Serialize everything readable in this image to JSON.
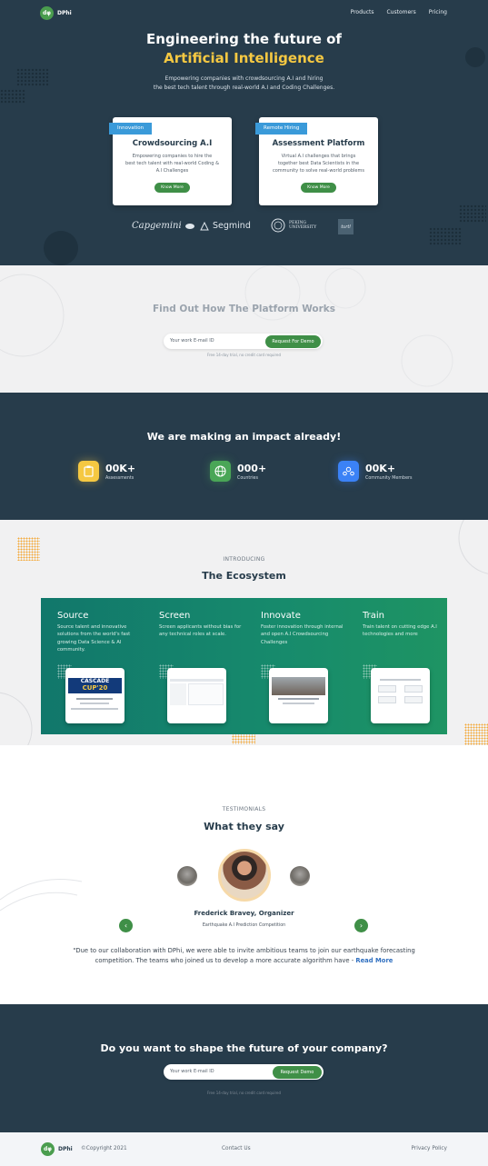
{
  "brand": {
    "logo_mark": "dφ",
    "name": "DPhi"
  },
  "nav": {
    "items": [
      "Products",
      "Customers",
      "Pricing"
    ]
  },
  "hero": {
    "title_line1": "Engineering the future of",
    "title_line2": "Artificial Intelligence",
    "subtitle_line1": "Empowering companies with crowdsourcing A.I and hiring",
    "subtitle_line2": "the best tech talent through real-world A.I and Coding Challenges."
  },
  "cards": [
    {
      "tag": "Innovation",
      "title": "Crowdsourcing A.I",
      "text_line1": "Empowering companies to hire the",
      "text_line2": "best tech talent with real-world Coding &",
      "text_line3": "A.I Challenges",
      "button": "Know More"
    },
    {
      "tag": "Remote Hiring",
      "title": "Assessment Platform",
      "text_line1": "Virtual A.I challenges that brings",
      "text_line2": "together best Data Scientists in the",
      "text_line3": "community to solve real-world problems",
      "button": "Know More"
    }
  ],
  "partners": {
    "capgemini": "Capgemini",
    "segmind": "Segmind",
    "peking_line1": "PEKING",
    "peking_line2": "UNIVERSITY",
    "turtl": "turtl"
  },
  "demo": {
    "title": "Find Out How The Platform Works",
    "email_placeholder": "Your work E-mail ID",
    "button": "Request For Demo",
    "note": "Free 14-day trial, no credit card required"
  },
  "impact": {
    "title": "We are making an impact already!",
    "stats": [
      {
        "value": "00K+",
        "label": "Assessments",
        "icon": "clipboard-icon",
        "color": "#f5c842"
      },
      {
        "value": "000+",
        "label": "Countries",
        "icon": "globe-icon",
        "color": "#4aa657"
      },
      {
        "value": "00K+",
        "label": "Community Members",
        "icon": "community-icon",
        "color": "#3b82f6"
      }
    ]
  },
  "ecosystem": {
    "intro": "INTRODUCING",
    "title": "The Ecosystem",
    "columns": [
      {
        "title": "Source",
        "text": "Source talent and innovative solutions from the world's fast growing Data Science & AI community."
      },
      {
        "title": "Screen",
        "text": "Screen applicants without bias for any technical roles at scale."
      },
      {
        "title": "Innovate",
        "text": "Foster innovation through internal and open A.I Crowdsourcing Challenges"
      },
      {
        "title": "Train",
        "text": "Train talent on cutting edge A.I technologies and more"
      }
    ],
    "cascade_line1": "CASCADE",
    "cascade_line2": "CUP'20"
  },
  "testimonials": {
    "intro": "TESTIMONIALS",
    "title": "What they say",
    "name": "Frederick Bravey, Organizer",
    "role": "Earthquake A.I Prediction Competition",
    "quote": "\"Due to our collaboration with DPhi, we were able to invite ambitious teams to join our earthquake forecasting competition. The teams who joined us to develop a more accurate algorithm have - ",
    "read_more": "Read More"
  },
  "cta": {
    "title": "Do you want to shape the future of your company?",
    "email_placeholder": "Your work E-mail ID",
    "button": "Request Demo",
    "note": "Free 14-day trial, no credit card required"
  },
  "footer": {
    "copyright": "©Copyright 2021",
    "contact": "Contact Us",
    "privacy": "Privacy Policy"
  },
  "colors": {
    "navy": "#273c4b",
    "green": "#3f8f47",
    "yellow": "#f5c842",
    "blue_tag": "#3a9ad9",
    "teal_panel": "#11776b"
  }
}
